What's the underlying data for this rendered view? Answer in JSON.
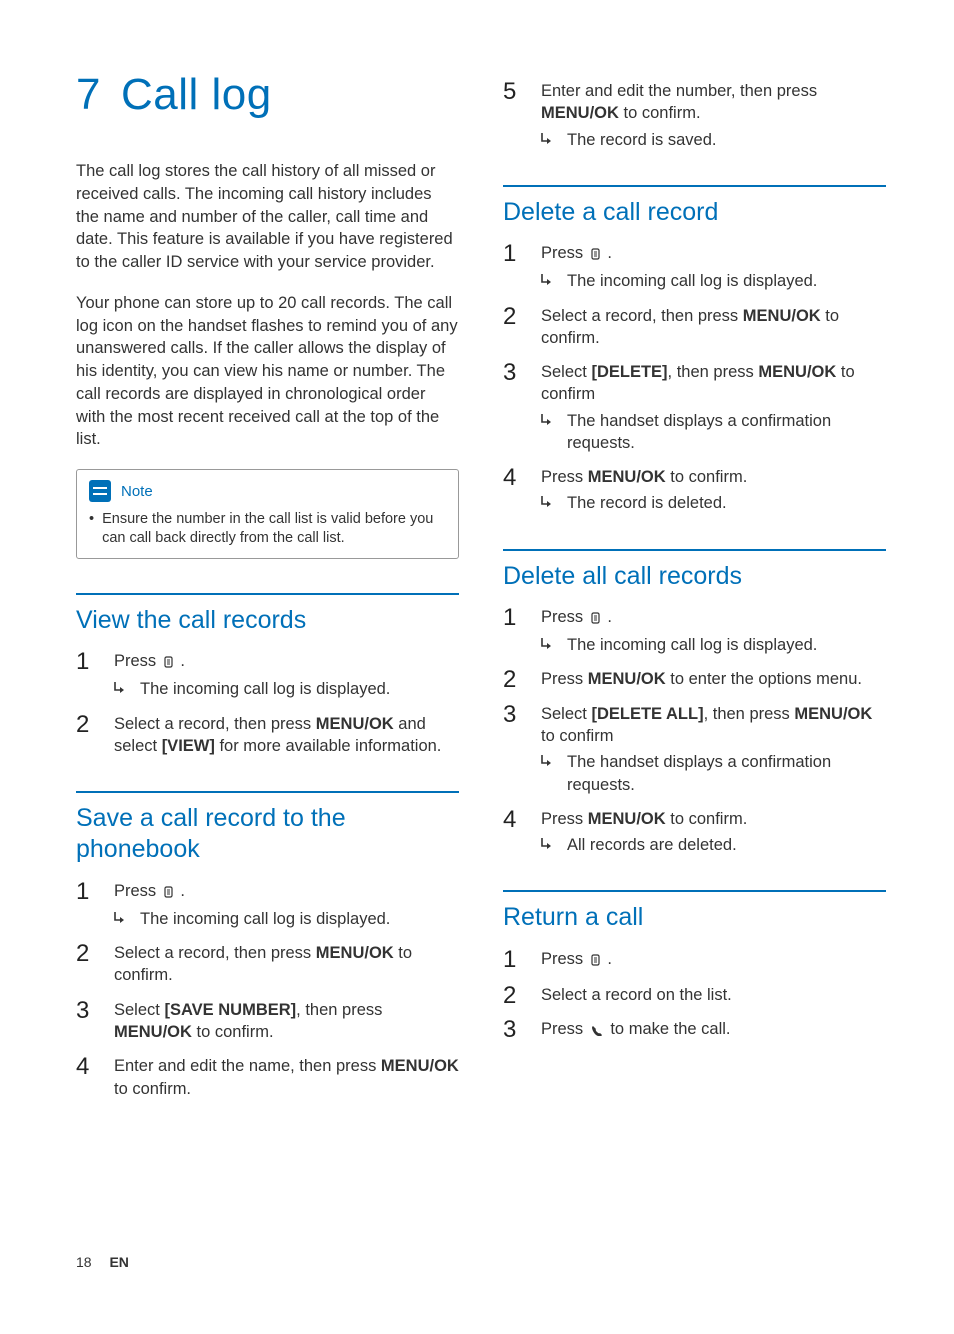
{
  "chapter": {
    "number": "7",
    "title": "Call log"
  },
  "intro_p1": "The call log stores the call history of all missed or received calls. The incoming call history includes the name and number of the caller, call time and date. This feature is available if you have registered to the caller ID service with your service provider.",
  "intro_p2": "Your phone can store up to 20 call records. The call log icon on the handset flashes to remind you of any unanswered calls. If the caller allows the display of his identity, you can view his name or number. The call records are displayed in chronological order with the most recent received call at the top of the list.",
  "note": {
    "label": "Note",
    "text": "Ensure the number in the call list is valid before you can call back directly from the call list."
  },
  "sections": {
    "view": {
      "title": "View the call records",
      "step1_pre": "Press ",
      "step1_post": " .",
      "step1_result": "The incoming call log is displayed.",
      "step2_a": "Select a record, then press ",
      "step2_b": "MENU/OK",
      "step2_c": " and select ",
      "step2_d": "[VIEW]",
      "step2_e": " for more available information."
    },
    "save": {
      "title": "Save a call record to the phonebook",
      "step1_pre": "Press ",
      "step1_post": " .",
      "step1_result": "The incoming call log is displayed.",
      "step2_a": "Select a record, then press ",
      "step2_b": "MENU/OK",
      "step2_c": " to confirm.",
      "step3_a": "Select ",
      "step3_b": "[SAVE NUMBER]",
      "step3_c": ", then press ",
      "step3_d": "MENU/OK",
      "step3_e": " to confirm.",
      "step4_a": "Enter and edit the name, then press ",
      "step4_b": "MENU/OK",
      "step4_c": " to confirm.",
      "step5_a": "Enter and edit the number, then press ",
      "step5_b": "MENU/OK",
      "step5_c": " to confirm.",
      "step5_result": "The record is saved."
    },
    "deleteOne": {
      "title": "Delete a call record",
      "step1_pre": "Press ",
      "step1_post": " .",
      "step1_result": "The incoming call log is displayed.",
      "step2_a": "Select a record, then press ",
      "step2_b": "MENU/OK",
      "step2_c": " to confirm.",
      "step3_a": "Select ",
      "step3_b": "[DELETE]",
      "step3_c": ", then press ",
      "step3_d": "MENU/OK",
      "step3_e": " to confirm",
      "step3_result": "The handset displays a confirmation requests.",
      "step4_a": "Press ",
      "step4_b": "MENU/OK",
      "step4_c": " to confirm.",
      "step4_result": "The record is deleted."
    },
    "deleteAll": {
      "title": "Delete all call records",
      "step1_pre": "Press ",
      "step1_post": " .",
      "step1_result": "The incoming call log is displayed.",
      "step2_a": "Press ",
      "step2_b": "MENU/OK",
      "step2_c": " to enter the options menu.",
      "step3_a": "Select ",
      "step3_b": "[DELETE ALL]",
      "step3_c": ", then press ",
      "step3_d": "MENU/OK",
      "step3_e": " to confirm",
      "step3_result": "The handset displays a confirmation requests.",
      "step4_a": "Press ",
      "step4_b": "MENU/OK",
      "step4_c": " to confirm.",
      "step4_result": "All records are deleted."
    },
    "returnCall": {
      "title": "Return a call",
      "step1_pre": "Press ",
      "step1_post": " .",
      "step2": "Select a record on the list.",
      "step3_pre": "Press ",
      "step3_post": " to make the call."
    }
  },
  "footer": {
    "page": "18",
    "lang": "EN"
  }
}
